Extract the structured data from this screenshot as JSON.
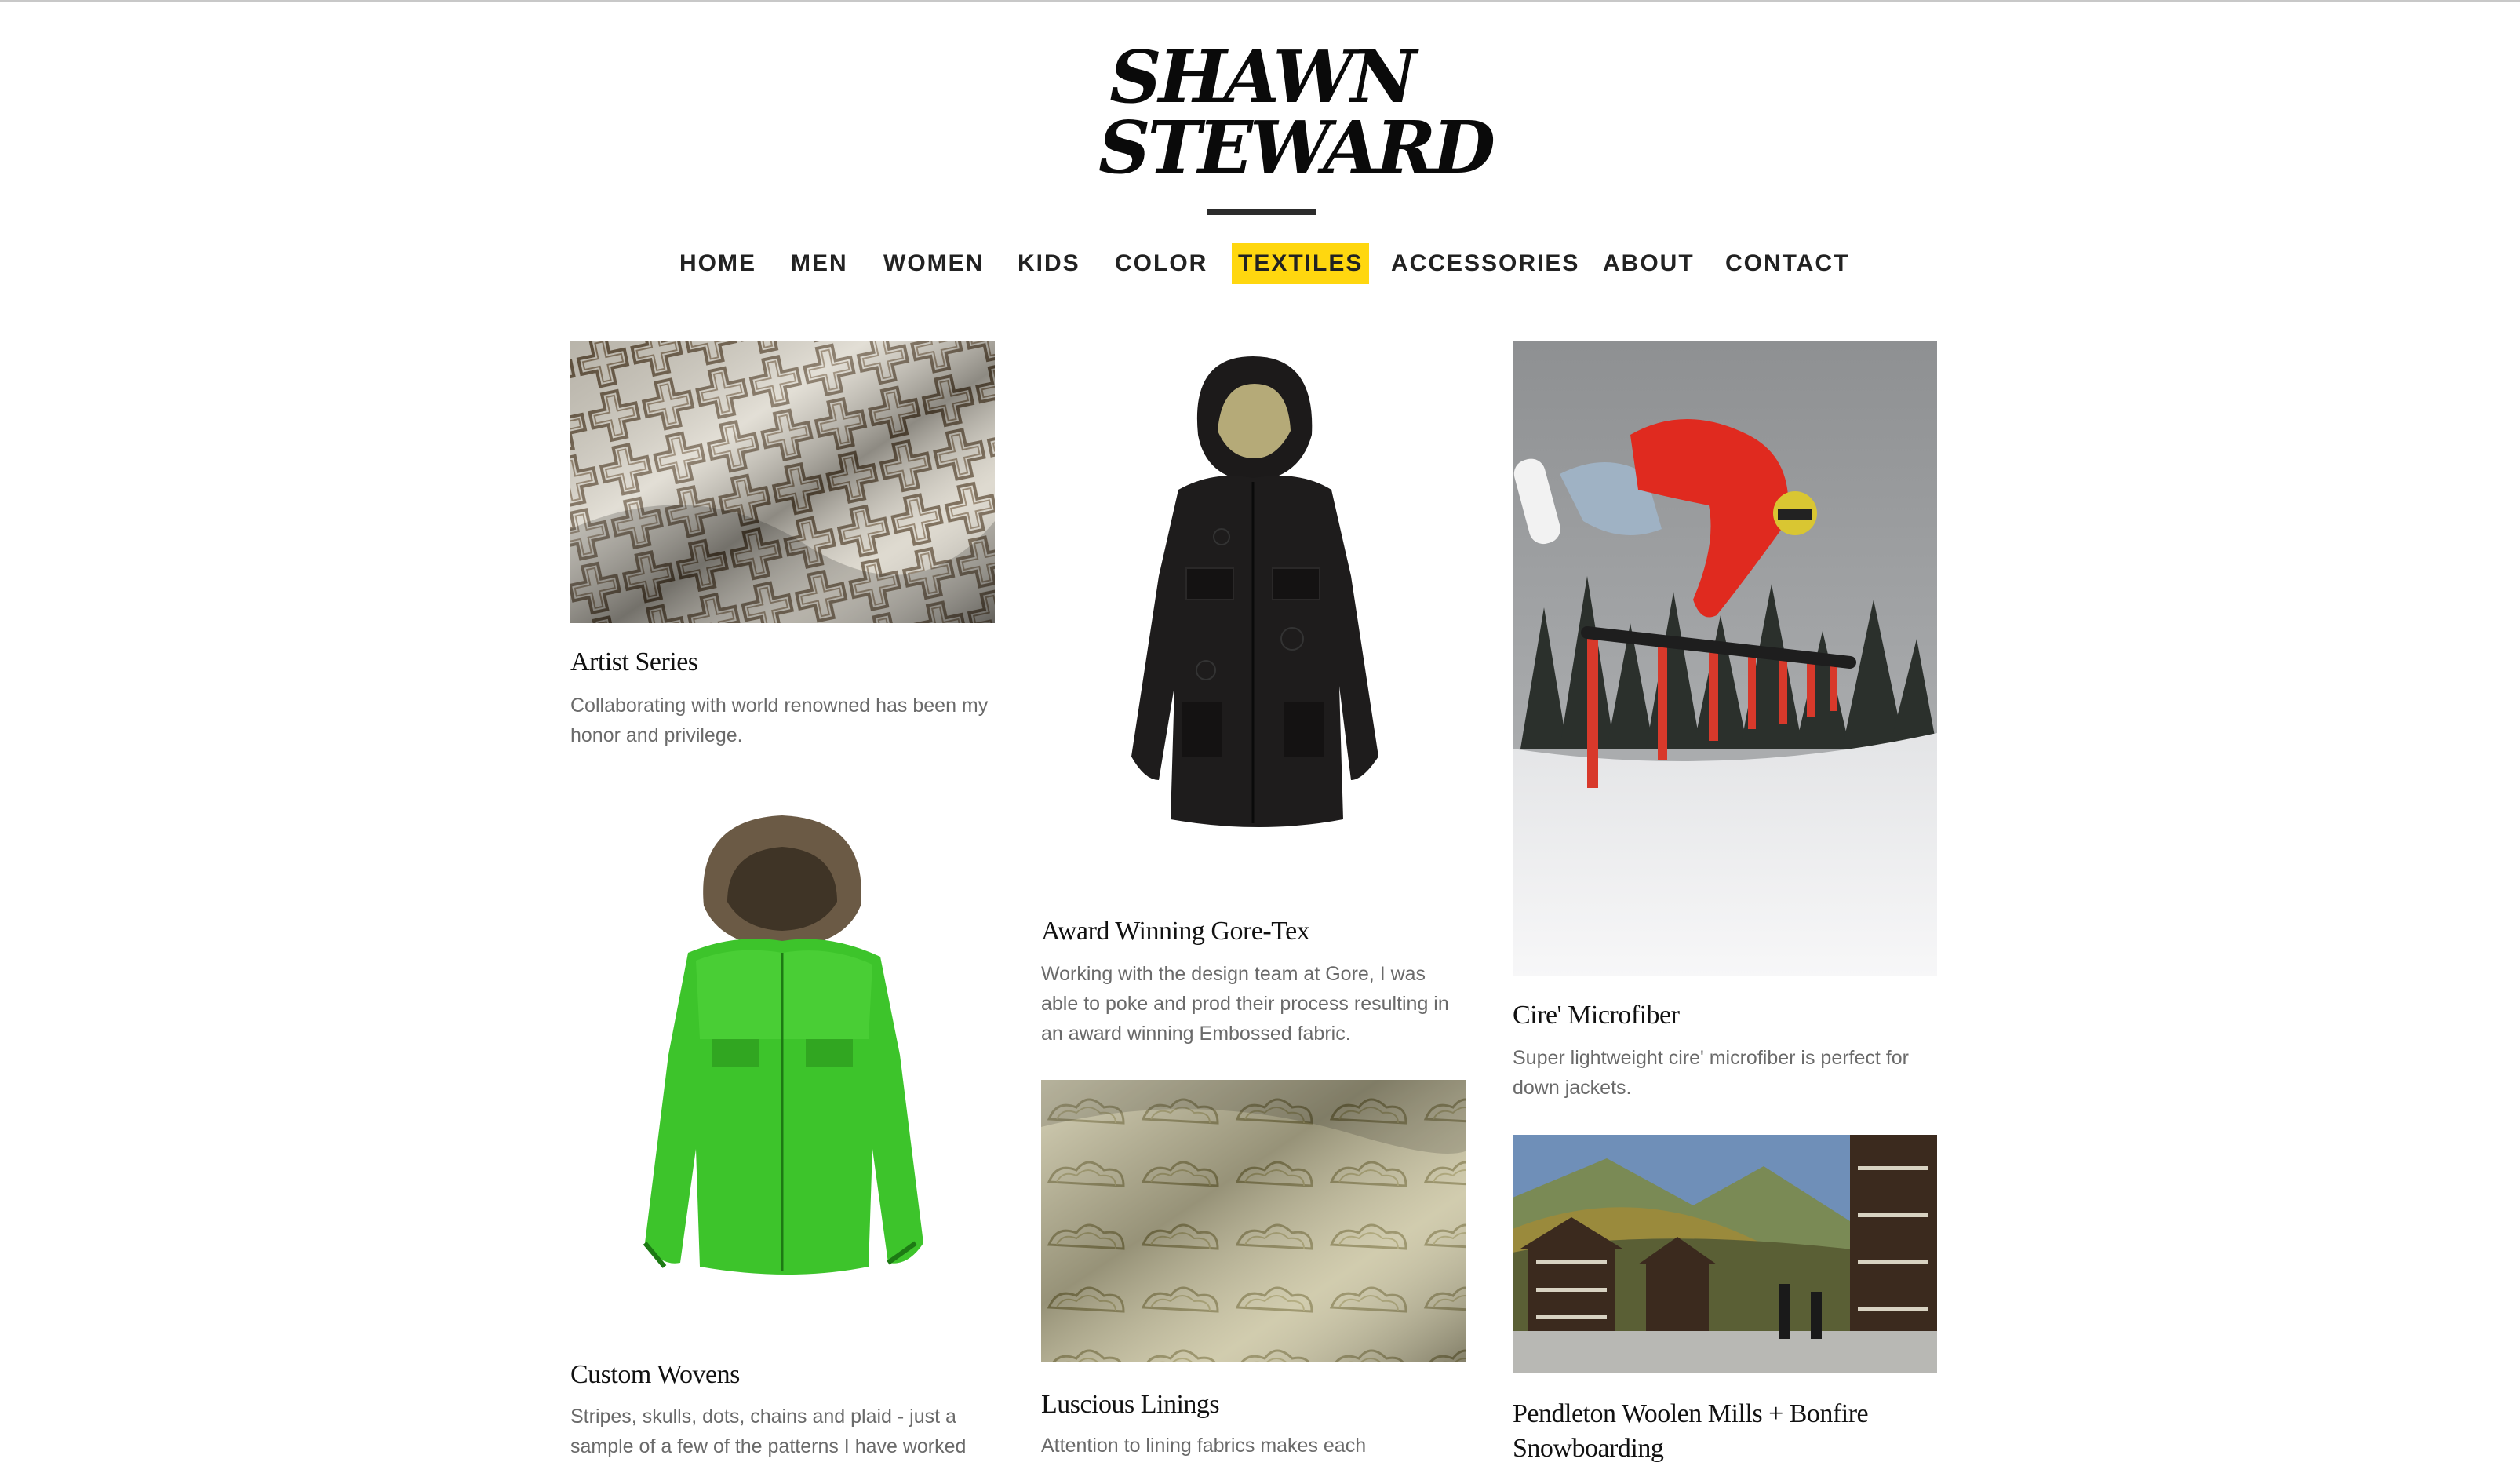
{
  "logo": {
    "line1": "SHAWN",
    "line2": "STEWARD"
  },
  "nav": {
    "items": [
      {
        "label": "HOME"
      },
      {
        "label": "MEN"
      },
      {
        "label": "WOMEN"
      },
      {
        "label": "KIDS"
      },
      {
        "label": "COLOR"
      },
      {
        "label": "TEXTILES",
        "active": true
      },
      {
        "label": "ACCESSORIES"
      },
      {
        "label": "ABOUT"
      },
      {
        "label": "CONTACT"
      }
    ],
    "active_color": "#ffd70f"
  },
  "cards": [
    {
      "title": "Artist Series",
      "description": "Collaborating with world renowned has been my honor and privilege.",
      "image": "textile-fabric-photo"
    },
    {
      "title": "Award Winning Gore-Tex",
      "description": "Working with the design team at Gore, I was able to poke and prod their process resulting in an award winning Embossed fabric.",
      "image": "black-jacket-photo"
    },
    {
      "title": "Cire' Microfiber",
      "description": "Super lightweight cire' microfiber is perfect for down jackets.",
      "image": "snowboarder-rail-photo"
    },
    {
      "title": "Custom Wovens",
      "description": "Stripes, skulls, dots, chains and plaid - just a sample of a few of the patterns I have worked",
      "image": "green-jacket-photo"
    },
    {
      "title": "Luscious Linings",
      "description": "Attention to lining fabrics makes each",
      "image": "lining-fabric-photo"
    },
    {
      "title": "Pendleton Woolen Mills + Bonfire Snowboarding",
      "description": "",
      "image": "mountain-village-photo"
    }
  ]
}
